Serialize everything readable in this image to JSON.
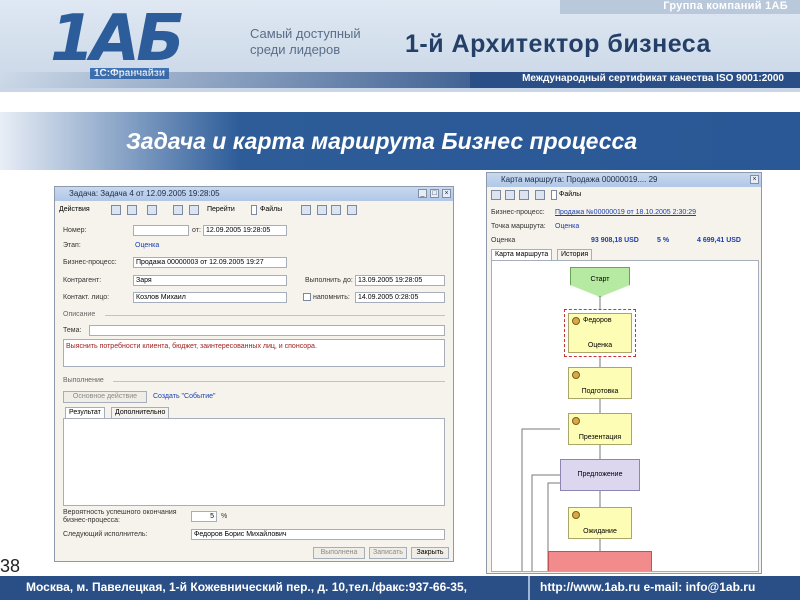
{
  "header": {
    "group": "Группа компаний 1АБ",
    "logo_text": "1АБ",
    "franchise": "1С:Франчайзи",
    "slogan_line1": "Самый доступный",
    "slogan_line2": "среди лидеров",
    "brand": "1-й Архитектор бизнеса",
    "certificate": "Международный сертификат качества ISO 9001:2000"
  },
  "slide_title": "Задача и карта маршрута Бизнес процесса",
  "slide_number": "38",
  "footer": {
    "address": "Москва, м. Павелецкая, 1-й Кожевнический пер., д. 10,тел./факс:937-66-35,",
    "contacts": "http://www.1ab.ru    e-mail: info@1ab.ru"
  },
  "task_window": {
    "title": "Задача: Задача 4 от 12.09.2005 19:28:05",
    "toolbar": {
      "actions": "Действия",
      "goto": "Перейти",
      "files": "Файлы"
    },
    "fields": {
      "number_label": "Номер:",
      "number_value": "",
      "from_label": "от:",
      "from_value": "12.09.2005 19:28:05",
      "stage_label": "Этап:",
      "stage_value": "Оценка",
      "process_label": "Бизнес-процесс:",
      "process_value": "Продажа 00000003 от 12.09.2005 19:27",
      "counterparty_label": "Контрагент:",
      "counterparty_value": "Заря",
      "contact_label": "Контакт. лицо:",
      "contact_value": "Козлов Михаил",
      "due_label": "Выполнить до:",
      "due_value": "13.09.2005 19:28:05",
      "remind_label": "напомнить:",
      "remind_value": "14.09.2005 0:28:05"
    },
    "description_section": "Описание",
    "topic_label": "Тема:",
    "description_text": "Выяснить потребности клиента, бюджет, заинтересованных лиц, и спонсора.",
    "execution_section": "Выполнение",
    "main_action": "Основное действие",
    "create_event": "Создать \"Событие\"",
    "tabs": [
      "Результат",
      "Дополнительно"
    ],
    "probability_label": "Вероятность успешного окончания бизнес-процесса:",
    "probability_value": "5",
    "probability_unit": "%",
    "next_label": "Следующий исполнитель:",
    "next_value": "Федоров Борис Михайлович",
    "buttons": {
      "done": "Выполнена",
      "save": "Записать",
      "close": "Закрыть"
    }
  },
  "process_window": {
    "title": "Карта маршрута: Продажа 00000019.... 29",
    "toolbar_files": "Файлы",
    "process_label": "Бизнес-процесс:",
    "process_value": "Продажа №00000019 от 18.10.2005 2:30:29",
    "route_point_label": "Точка маршрута:",
    "route_point_value": "Оценка",
    "estimate_label": "Оценка",
    "estimate_value": "93 908,18 USD",
    "percent_value": "5 %",
    "amount_value": "4 699,41 USD",
    "tabs": [
      "Карта маршрута",
      "История"
    ],
    "nodes": {
      "start": "Старт",
      "assignee": "Федоров",
      "estimate": "Оценка",
      "preparation": "Подготовка",
      "presentation": "Презентация",
      "offer": "Предложение",
      "waiting": "Ожидание"
    }
  }
}
